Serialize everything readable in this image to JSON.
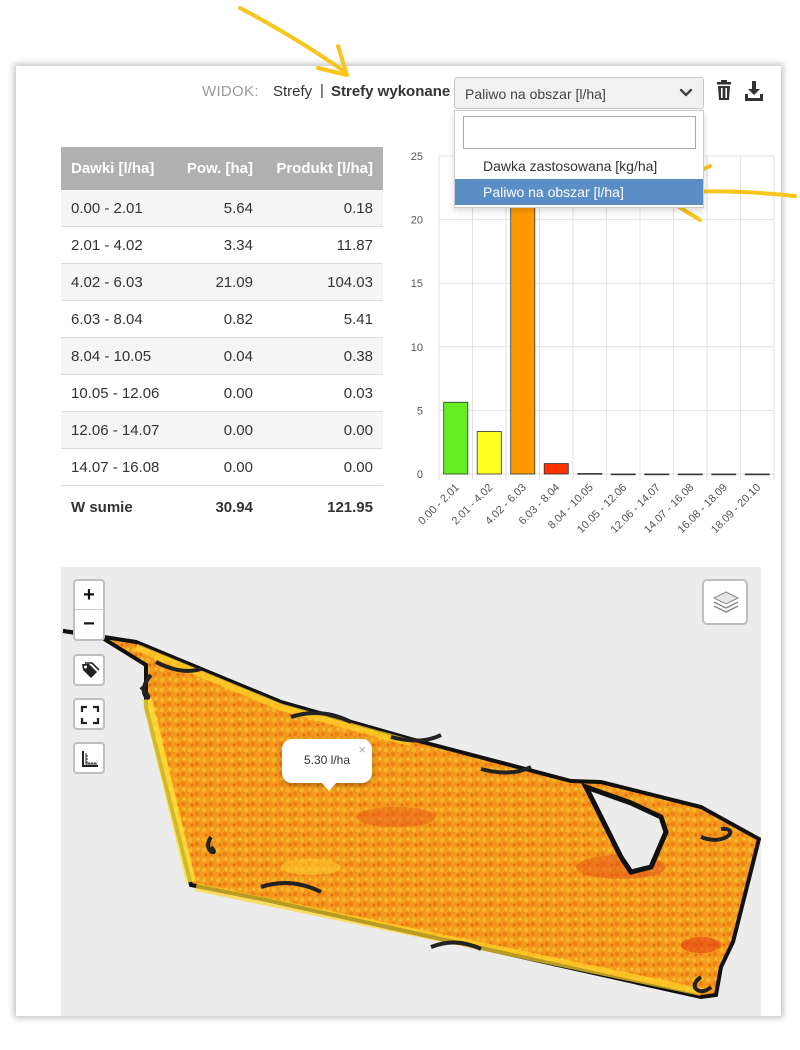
{
  "toolbar": {
    "view_label": "WIDOK:",
    "view_options": [
      "Strefy",
      "Strefy wykonane"
    ],
    "separator": "|",
    "select_value": "Paliwo na obszar [l/ha]"
  },
  "dropdown": {
    "search_value": "",
    "options": [
      "Dawka zastosowana [kg/ha]",
      "Paliwo na obszar [l/ha]"
    ],
    "selected_index": 1
  },
  "table": {
    "headers": [
      "Dawki [l/ha]",
      "Pow. [ha]",
      "Produkt [l/ha]"
    ],
    "rows": [
      [
        "0.00 - 2.01",
        "5.64",
        "0.18"
      ],
      [
        "2.01 - 4.02",
        "3.34",
        "11.87"
      ],
      [
        "4.02 - 6.03",
        "21.09",
        "104.03"
      ],
      [
        "6.03 - 8.04",
        "0.82",
        "5.41"
      ],
      [
        "8.04 - 10.05",
        "0.04",
        "0.38"
      ],
      [
        "10.05 - 12.06",
        "0.00",
        "0.03"
      ],
      [
        "12.06 - 14.07",
        "0.00",
        "0.00"
      ],
      [
        "14.07 - 16.08",
        "0.00",
        "0.00"
      ]
    ],
    "total": [
      "W sumie",
      "30.94",
      "121.95"
    ]
  },
  "chart_data": {
    "type": "bar",
    "categories": [
      "0.00 - 2.01",
      "2.01 - 4.02",
      "4.02 - 6.03",
      "6.03 - 8.04",
      "8.04 - 10.05",
      "10.05 - 12.06",
      "12.06 - 14.07",
      "14.07 - 16.08",
      "16.08 - 18.09",
      "18.09 - 20.10"
    ],
    "values": [
      5.64,
      3.34,
      21.09,
      0.82,
      0.04,
      0.0,
      0.0,
      0.0,
      0.0,
      0.0
    ],
    "colors": [
      "#66ee22",
      "#ffff22",
      "#ff9900",
      "#ff3300",
      "#cc0000",
      "#990000",
      "#990000",
      "#990000",
      "#990000",
      "#990000"
    ],
    "ylim": [
      0,
      25
    ],
    "yticks": [
      0,
      5,
      10,
      15,
      20,
      25
    ],
    "grid": true
  },
  "map": {
    "zoom_in": "+",
    "zoom_out": "−",
    "popup_text": "5.30 l/ha",
    "popup_close": "×"
  },
  "colors": {
    "header_bg": "#b0b0b0",
    "selected_option": "#5b8ec4",
    "annotation_arrow": "#f7c51c"
  }
}
